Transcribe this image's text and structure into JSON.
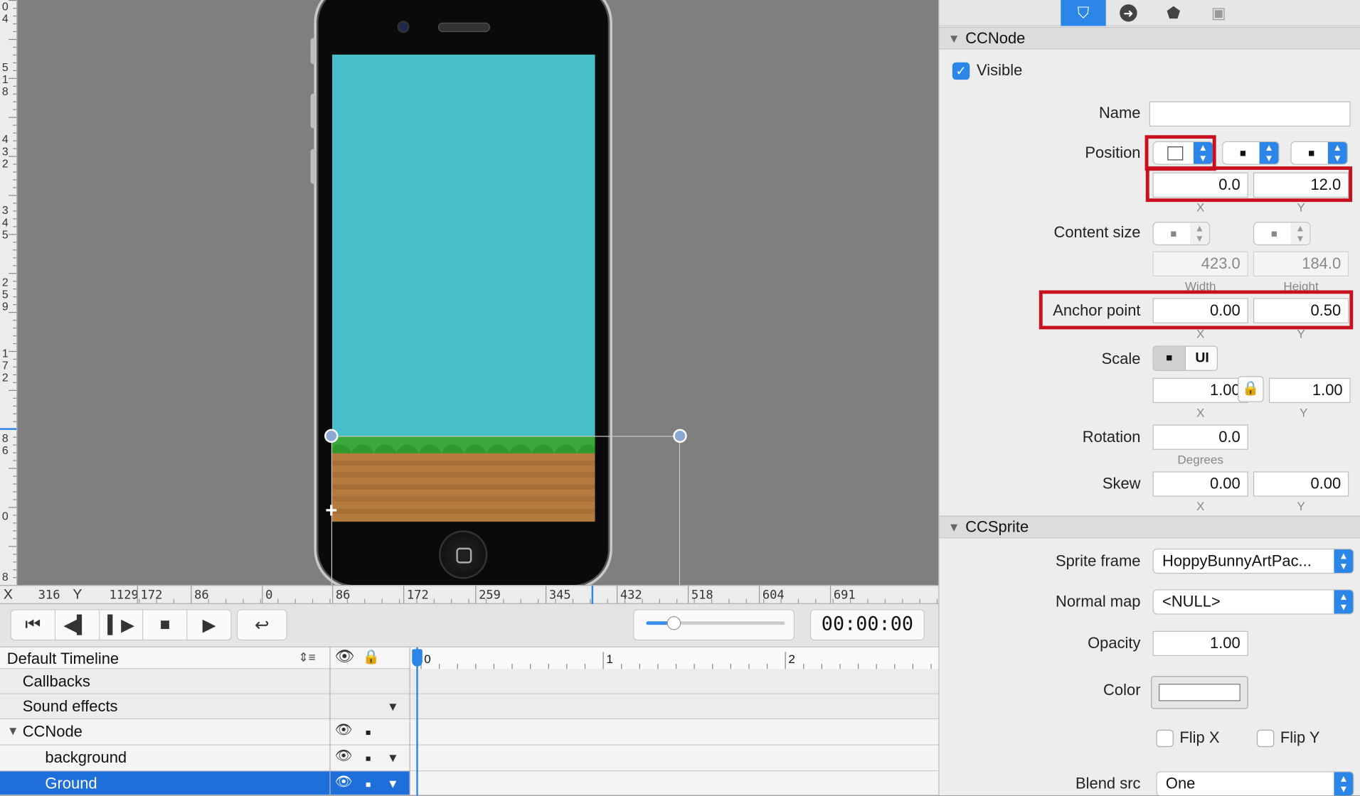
{
  "canvas": {
    "vertical_ruler_labels": [
      "0",
      "4",
      "5",
      "1",
      "8",
      "4",
      "3",
      "2",
      "3",
      "4",
      "5",
      "2",
      "5",
      "9",
      "1",
      "7",
      "2",
      "8",
      "6",
      "0",
      "8"
    ],
    "colors": {
      "sky": "#47bfcb",
      "grass": "#3aa83a",
      "dirt": "#b57a3e",
      "selection_handle": "#8aa7d6"
    }
  },
  "ruler": {
    "x_label": "X",
    "x_value": "316",
    "y_label": "Y",
    "y_value": "1129",
    "ticks": [
      "172",
      "86",
      "0",
      "86",
      "172",
      "259",
      "345",
      "432",
      "518",
      "604",
      "691"
    ]
  },
  "transport": {
    "buttons": [
      {
        "name": "jump-to-start",
        "glyph": "⏮"
      },
      {
        "name": "step-back",
        "glyph": "◀▍"
      },
      {
        "name": "step-forward",
        "glyph": "▍▶"
      },
      {
        "name": "stop",
        "glyph": "■"
      },
      {
        "name": "play",
        "glyph": "▶"
      }
    ],
    "loop_glyph": "↩",
    "zoom_level": 0.2,
    "timecode": "00:00:00"
  },
  "timeline": {
    "header": "Default Timeline",
    "scale_labels": [
      "0",
      "1",
      "2"
    ],
    "rows": [
      {
        "label": "Callbacks",
        "indent": false,
        "selected": false
      },
      {
        "label": "Sound effects",
        "indent": false,
        "selected": false
      },
      {
        "label": "CCNode",
        "indent": false,
        "selected": false,
        "expanded": true
      },
      {
        "label": "background",
        "indent": true,
        "selected": false
      },
      {
        "label": "Ground",
        "indent": true,
        "selected": true
      }
    ]
  },
  "inspector": {
    "tabs": [
      "properties",
      "code-connections",
      "physics",
      "templates"
    ],
    "ccnode": {
      "title": "CCNode",
      "visible_label": "Visible",
      "visible_checked": true,
      "name_label": "Name",
      "name_value": "",
      "position_label": "Position",
      "position_x": "0.0",
      "position_y": "12.0",
      "x_sub": "X",
      "y_sub": "Y",
      "content_size_label": "Content size",
      "content_width": "423.0",
      "content_height": "184.0",
      "width_sub": "Width",
      "height_sub": "Height",
      "anchor_label": "Anchor point",
      "anchor_x": "0.00",
      "anchor_y": "0.50",
      "scale_label": "Scale",
      "scale_ui": "UI",
      "scale_x": "1.00",
      "scale_y": "1.00",
      "rotation_label": "Rotation",
      "rotation_value": "0.0",
      "degrees_sub": "Degrees",
      "skew_label": "Skew",
      "skew_x": "0.00",
      "skew_y": "0.00"
    },
    "ccsprite": {
      "title": "CCSprite",
      "sprite_frame_label": "Sprite frame",
      "sprite_frame_value": "HoppyBunnyArtPac...",
      "normal_map_label": "Normal map",
      "normal_map_value": "<NULL>",
      "opacity_label": "Opacity",
      "opacity_value": "1.00",
      "color_label": "Color",
      "color_value": "#ffffff",
      "flip_x_label": "Flip X",
      "flip_y_label": "Flip Y",
      "blend_src_label": "Blend src",
      "blend_src_value": "One"
    },
    "accent_color": "#2b86e8",
    "highlight_color": "#c8101e"
  }
}
